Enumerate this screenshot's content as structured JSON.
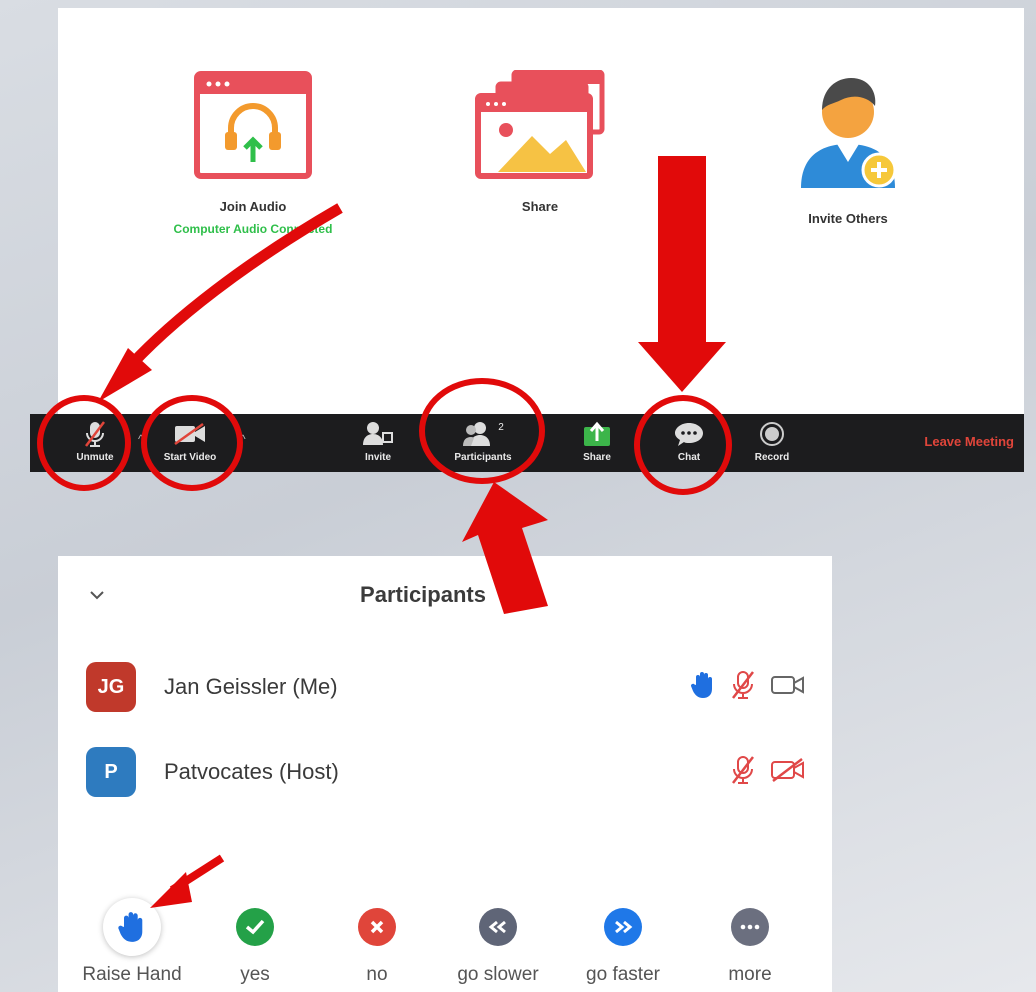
{
  "meeting": {
    "join_audio": {
      "label": "Join Audio",
      "status": "Computer Audio Connected",
      "icon": "headphones-window-icon"
    },
    "share": {
      "label": "Share",
      "icon": "share-screen-icon"
    },
    "invite": {
      "label": "Invite Others",
      "icon": "invite-person-icon"
    }
  },
  "toolbar": {
    "unmute": "Unmute",
    "start_video": "Start Video",
    "invite": "Invite",
    "participants": "Participants",
    "participants_count": "2",
    "share": "Share",
    "chat": "Chat",
    "record": "Record",
    "leave": "Leave Meeting"
  },
  "participants_panel": {
    "title": "Participants",
    "rows": [
      {
        "initials": "JG",
        "name": "Jan Geissler (Me)",
        "avatar_color": "#c0392b",
        "hand_raised": true,
        "muted": true,
        "video_on": true
      },
      {
        "initials": "P",
        "name": "Patvocates (Host)",
        "avatar_color": "#2e7bbf",
        "hand_raised": false,
        "muted": true,
        "video_on": false
      }
    ],
    "reactions": {
      "raise_hand": "Raise Hand",
      "yes": "yes",
      "no": "no",
      "go_slower": "go slower",
      "go_faster": "go faster",
      "more": "more"
    }
  },
  "colors": {
    "toolbar_bg": "#1c1c1e",
    "leave": "#e0453a",
    "annotation_red": "#e10a0a",
    "hand_blue": "#1f6fe0",
    "muted_red": "#e04848"
  }
}
